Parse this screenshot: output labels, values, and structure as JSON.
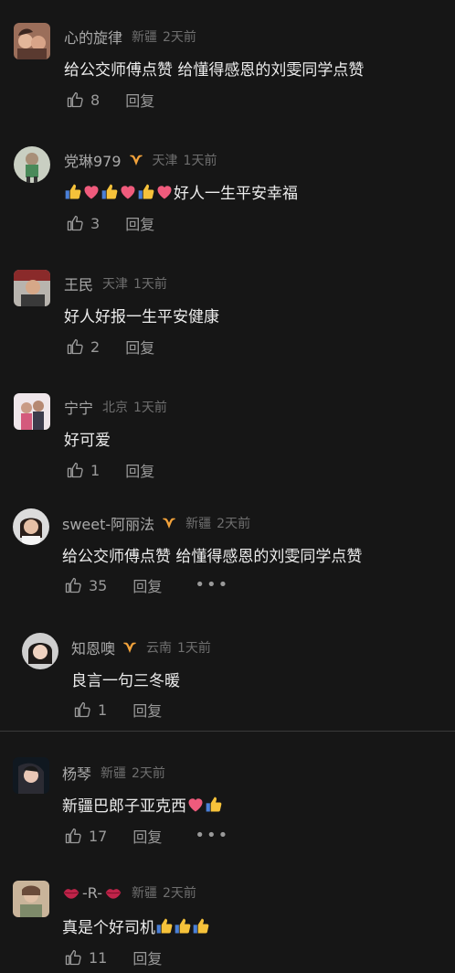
{
  "comments": [
    {
      "username": "心的旋律",
      "location": "新疆",
      "time": "2天前",
      "text": "给公交师傅点赞 给懂得感恩的刘雯同学点赞",
      "likes": "8",
      "reply": "回复"
    },
    {
      "username": "党琳979",
      "location": "天津",
      "time": "1天前",
      "text": "好人一生平安幸福",
      "likes": "3",
      "reply": "回复"
    },
    {
      "username": "王民",
      "location": "天津",
      "time": "1天前",
      "text": "好人好报一生平安健康",
      "likes": "2",
      "reply": "回复"
    },
    {
      "username": "宁宁",
      "location": "北京",
      "time": "1天前",
      "text": "好可爱",
      "likes": "1",
      "reply": "回复"
    },
    {
      "username": "sweet-阿丽法",
      "location": "新疆",
      "time": "2天前",
      "text": "给公交师傅点赞 给懂得感恩的刘雯同学点赞",
      "likes": "35",
      "reply": "回复"
    },
    {
      "username": "知恩噢",
      "location": "云南",
      "time": "1天前",
      "text": "良言一句三冬暖",
      "likes": "1",
      "reply": "回复"
    },
    {
      "username": "杨琴",
      "location": "新疆",
      "time": "2天前",
      "text": "新疆巴郎子亚克西",
      "likes": "17",
      "reply": "回复"
    },
    {
      "username": "-R-",
      "location": "新疆",
      "time": "2天前",
      "text": "真是个好司机",
      "likes": "11",
      "reply": "回复"
    }
  ],
  "more_icon": "more-icon",
  "badge_color": "#f2a23b"
}
